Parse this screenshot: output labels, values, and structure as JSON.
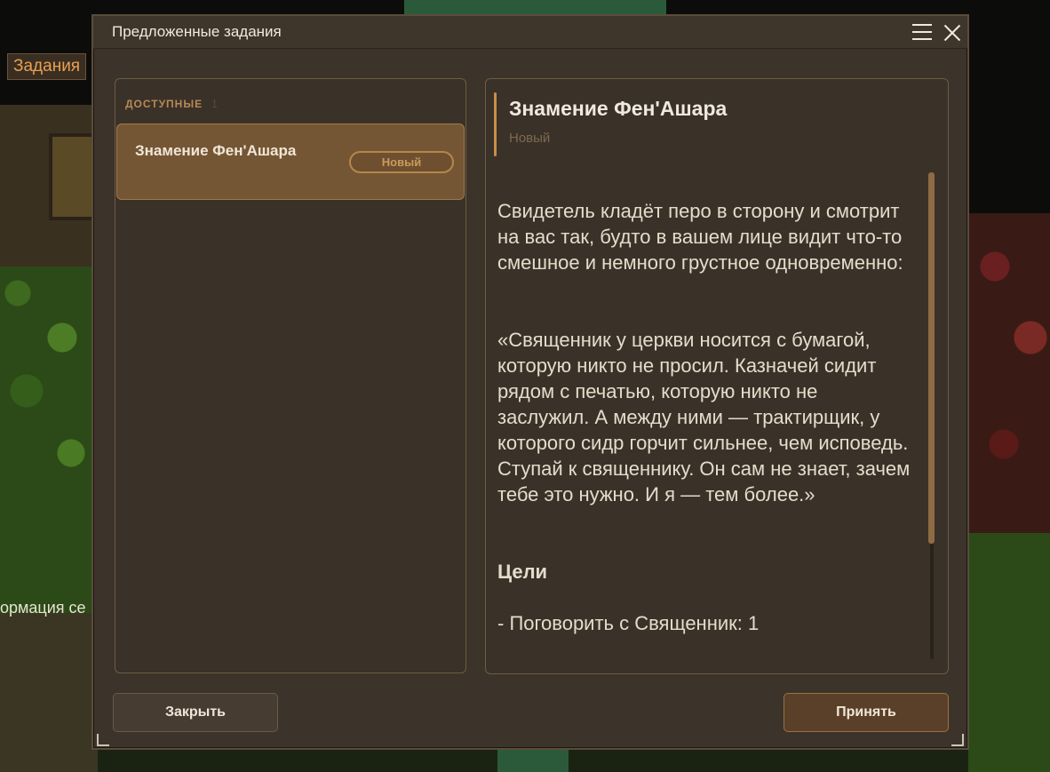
{
  "background": {
    "side_tab_label": "Задания",
    "side_info_text": "ормация се"
  },
  "window": {
    "title": "Предложенные задания",
    "menu_icon": "hamburger-menu-icon",
    "close_icon": "close-icon"
  },
  "quest_list": {
    "section_label": "ДОСТУПНЫЕ",
    "count": "1",
    "items": [
      {
        "title": "Знамение Фен'Ашара",
        "badge": "Новый"
      }
    ]
  },
  "detail": {
    "title": "Знамение Фен'Ашара",
    "status": "Новый",
    "paragraph_1": "Свидетель кладёт перо в сторону и смотрит на вас так, будто в вашем лице видит что-то смешное и немного грустное одновременно:",
    "paragraph_2": "«Священник у церкви носится с бумагой, которую никто не просил. Казначей сидит рядом с печатью, которую никто не заслужил. А между ними — трактирщик, у которого сидр горчит сильнее, чем исповедь. Ступай к священнику. Он сам не знает, зачем тебе это нужно. И я — тем более.»",
    "goals_label": "Цели",
    "goals": [
      "- Поговорить с Священник: 1"
    ]
  },
  "buttons": {
    "close_label": "Закрыть",
    "accept_label": "Принять"
  },
  "colors": {
    "accent": "#c88e4a",
    "panel_bg": "#3a3128",
    "selected_card": "#755634"
  }
}
